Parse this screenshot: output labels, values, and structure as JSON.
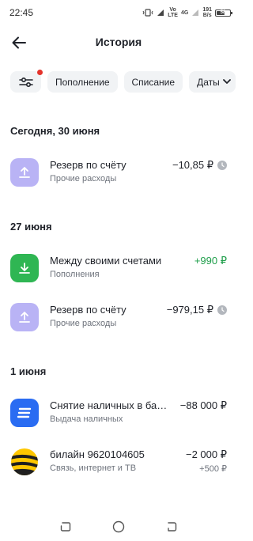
{
  "status_bar": {
    "time": "22:45",
    "net_vo": "Vo",
    "net_lte": "LTE",
    "net_4g": "4G",
    "speed_value": "191",
    "speed_unit": "B/s",
    "battery": "58"
  },
  "header": {
    "title": "История"
  },
  "filters": {
    "topup": "Пополнение",
    "withdraw": "Списание",
    "dates": "Даты"
  },
  "sections": [
    {
      "title": "Сегодня, 30 июня",
      "transactions": [
        {
          "title": "Резерв по счёту",
          "subtitle": "Прочие расходы",
          "amount": "−10,85 ₽",
          "icon": "upload-arrow-icon"
        }
      ]
    },
    {
      "title": "27 июня",
      "transactions": [
        {
          "title": "Между своими счетами",
          "subtitle": "Пополнения",
          "amount": "+990 ₽",
          "icon": "download-arrow-icon"
        },
        {
          "title": "Резерв по счёту",
          "subtitle": "Прочие расходы",
          "amount": "−979,15 ₽",
          "icon": "upload-arrow-icon"
        }
      ]
    },
    {
      "title": "1 июня",
      "transactions": [
        {
          "title": "Снятие наличных в банкомате",
          "subtitle": "Выдача наличных",
          "amount": "−88 000 ₽",
          "icon": "bank-stripes-icon"
        },
        {
          "title": "билайн 9620104605",
          "subtitle": "Связь, интернет и ТВ",
          "amount": "−2 000 ₽",
          "bonus": "+500 ₽",
          "icon": "beeline-logo-icon"
        }
      ]
    }
  ],
  "colors": {
    "accent_green": "#2fb653",
    "reserve_icon_bg": "#b9b3f5",
    "bank_icon_bg": "#2a6cf2",
    "beeline_yellow": "#ffc700",
    "positive_amount": "#1e9e4a",
    "filter_dot": "#e4332b"
  }
}
